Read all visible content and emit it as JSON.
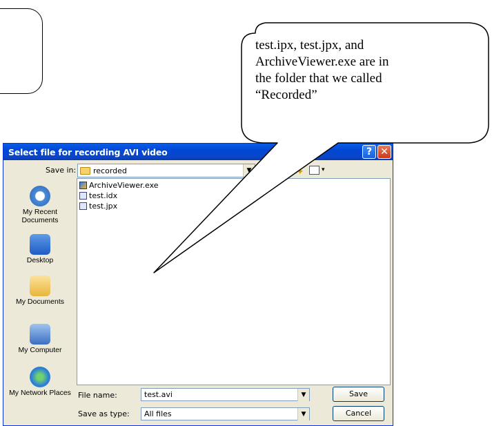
{
  "callout": {
    "lines": [
      "test.ipx, test.jpx, and",
      "ArchiveViewer.exe are in",
      "the folder that we called",
      "“Recorded”"
    ]
  },
  "dialog": {
    "title": "Select file for recording AVI video",
    "help_glyph": "?",
    "close_glyph": "✕",
    "save_in_label": "Save in:",
    "save_in_value": "recorded",
    "places": [
      {
        "label": "My Recent Documents",
        "icon": "recent-documents-icon"
      },
      {
        "label": "Desktop",
        "icon": "desktop-icon"
      },
      {
        "label": "My Documents",
        "icon": "my-documents-icon"
      },
      {
        "label": "My Computer",
        "icon": "my-computer-icon"
      },
      {
        "label": "My Network Places",
        "icon": "network-places-icon"
      }
    ],
    "files": [
      {
        "name": "ArchiveViewer.exe",
        "icon": "exe-file-icon"
      },
      {
        "name": "test.idx",
        "icon": "file-icon"
      },
      {
        "name": "test.jpx",
        "icon": "file-icon"
      }
    ],
    "file_name_label": "File name:",
    "file_name_value": "test.avi",
    "save_as_type_label": "Save as type:",
    "save_as_type_value": "All files",
    "save_button": "Save",
    "cancel_button": "Cancel",
    "colors": {
      "titlebar": "#0a5ce6",
      "dialog_bg": "#ece9d8",
      "close": "#c8391a"
    }
  }
}
